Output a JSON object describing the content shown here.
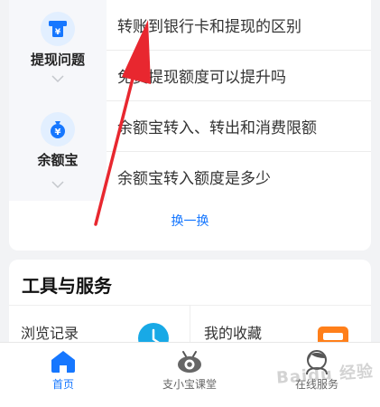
{
  "faq": {
    "categories": [
      {
        "label": "提现问题",
        "icon": "atm-card-icon"
      },
      {
        "label": "余额宝",
        "icon": "money-bag-icon"
      }
    ],
    "questions": [
      "转账到银行卡和提现的区别",
      "免费提现额度可以提升吗",
      "余额宝转入、转出和消费限额",
      "余额宝转入额度是多少"
    ],
    "refresh_label": "换一换"
  },
  "tools": {
    "title": "工具与服务",
    "items": [
      {
        "label": "浏览记录",
        "icon": "clock-icon"
      },
      {
        "label": "我的收藏",
        "icon": "folder-icon"
      }
    ]
  },
  "tabbar": {
    "items": [
      {
        "label": "首页",
        "icon": "home-icon",
        "active": true
      },
      {
        "label": "支小宝课堂",
        "icon": "eye-icon",
        "active": false
      },
      {
        "label": "在线服务",
        "icon": "agent-icon",
        "active": false
      }
    ]
  },
  "overlay": {
    "annotation": "red-arrow",
    "watermark": "Baidu 经验"
  },
  "colors": {
    "accent": "#1677ff",
    "arrow": "#e8272f",
    "page_bg": "#f2f3f5"
  }
}
